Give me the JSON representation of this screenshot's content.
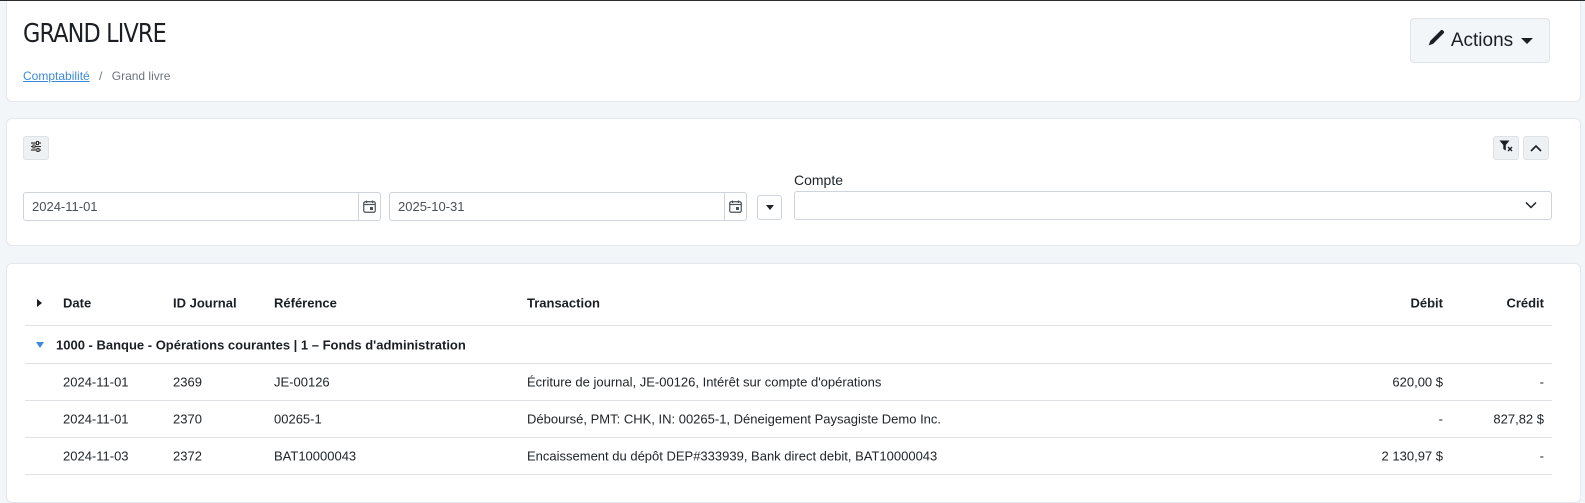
{
  "header": {
    "title": "GRAND LIVRE",
    "breadcrumb": {
      "link": "Comptabilité",
      "separator": "/",
      "current": "Grand livre"
    },
    "actions_label": "Actions"
  },
  "filters": {
    "date_from": "2024-11-01",
    "date_to": "2025-10-31",
    "compte_label": "Compte",
    "compte_value": ""
  },
  "table": {
    "columns": {
      "date": "Date",
      "journal_id": "ID Journal",
      "reference": "Référence",
      "transaction": "Transaction",
      "debit": "Débit",
      "credit": "Crédit"
    },
    "group_label": "1000 - Banque - Opérations courantes | 1 – Fonds d'administration",
    "rows": [
      {
        "date": "2024-11-01",
        "journal_id": "2369",
        "reference": "JE-00126",
        "transaction": "Écriture de journal, JE-00126, Intérêt sur compte d'opérations",
        "debit": "620,00 $",
        "credit": "-"
      },
      {
        "date": "2024-11-01",
        "journal_id": "2370",
        "reference": "00265-1",
        "transaction": "Déboursé, PMT: CHK, IN: 00265-1, Déneigement Paysagiste Demo Inc.",
        "debit": "-",
        "credit": "827,82 $"
      },
      {
        "date": "2024-11-03",
        "journal_id": "2372",
        "reference": "BAT10000043",
        "transaction": "Encaissement du dépôt DEP#333939, Bank direct debit, BAT10000043",
        "debit": "2 130,97 $",
        "credit": "-"
      }
    ]
  },
  "icons": {
    "actions": "pencil-icon",
    "settings": "sliders-icon",
    "clear_filter": "filter-x-icon",
    "collapse": "chevron-up-icon",
    "calendar": "calendar-icon",
    "select": "chevron-down-icon"
  },
  "colors": {
    "link": "#3b8ad9",
    "page_bg": "#f3f6f9"
  }
}
